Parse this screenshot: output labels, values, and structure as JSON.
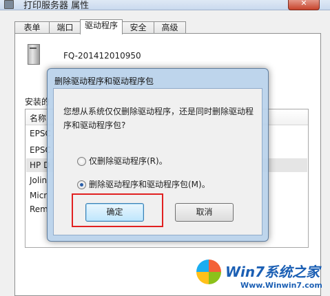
{
  "window": {
    "title": "打印服务器 属性",
    "close_glyph": "✕"
  },
  "tabs": [
    {
      "label": "表单"
    },
    {
      "label": "端口"
    },
    {
      "label": "驱动程序"
    },
    {
      "label": "安全"
    },
    {
      "label": "高级"
    }
  ],
  "server": {
    "name": "FQ-201412010950"
  },
  "drivers": {
    "section_label": "安装的",
    "column_header": "名称",
    "rows": [
      "EPSC",
      "EPSC",
      "HP D",
      "Jolin",
      "Micr",
      "Rem"
    ]
  },
  "dialog": {
    "title": "删除驱动程序和驱动程序包",
    "question": "您想从系统仅仅删除驱动程序，还是同时删除驱动程序和驱动程序包?",
    "options": [
      {
        "label": "仅删除驱动程序(R)。",
        "checked": false
      },
      {
        "label": "删除驱动程序和驱动程序包(M)。",
        "checked": true
      }
    ],
    "ok_label": "确定",
    "cancel_label": "取消"
  },
  "watermark": {
    "brand": "Win7系统之家",
    "url": "Www.Winwin7.com"
  }
}
